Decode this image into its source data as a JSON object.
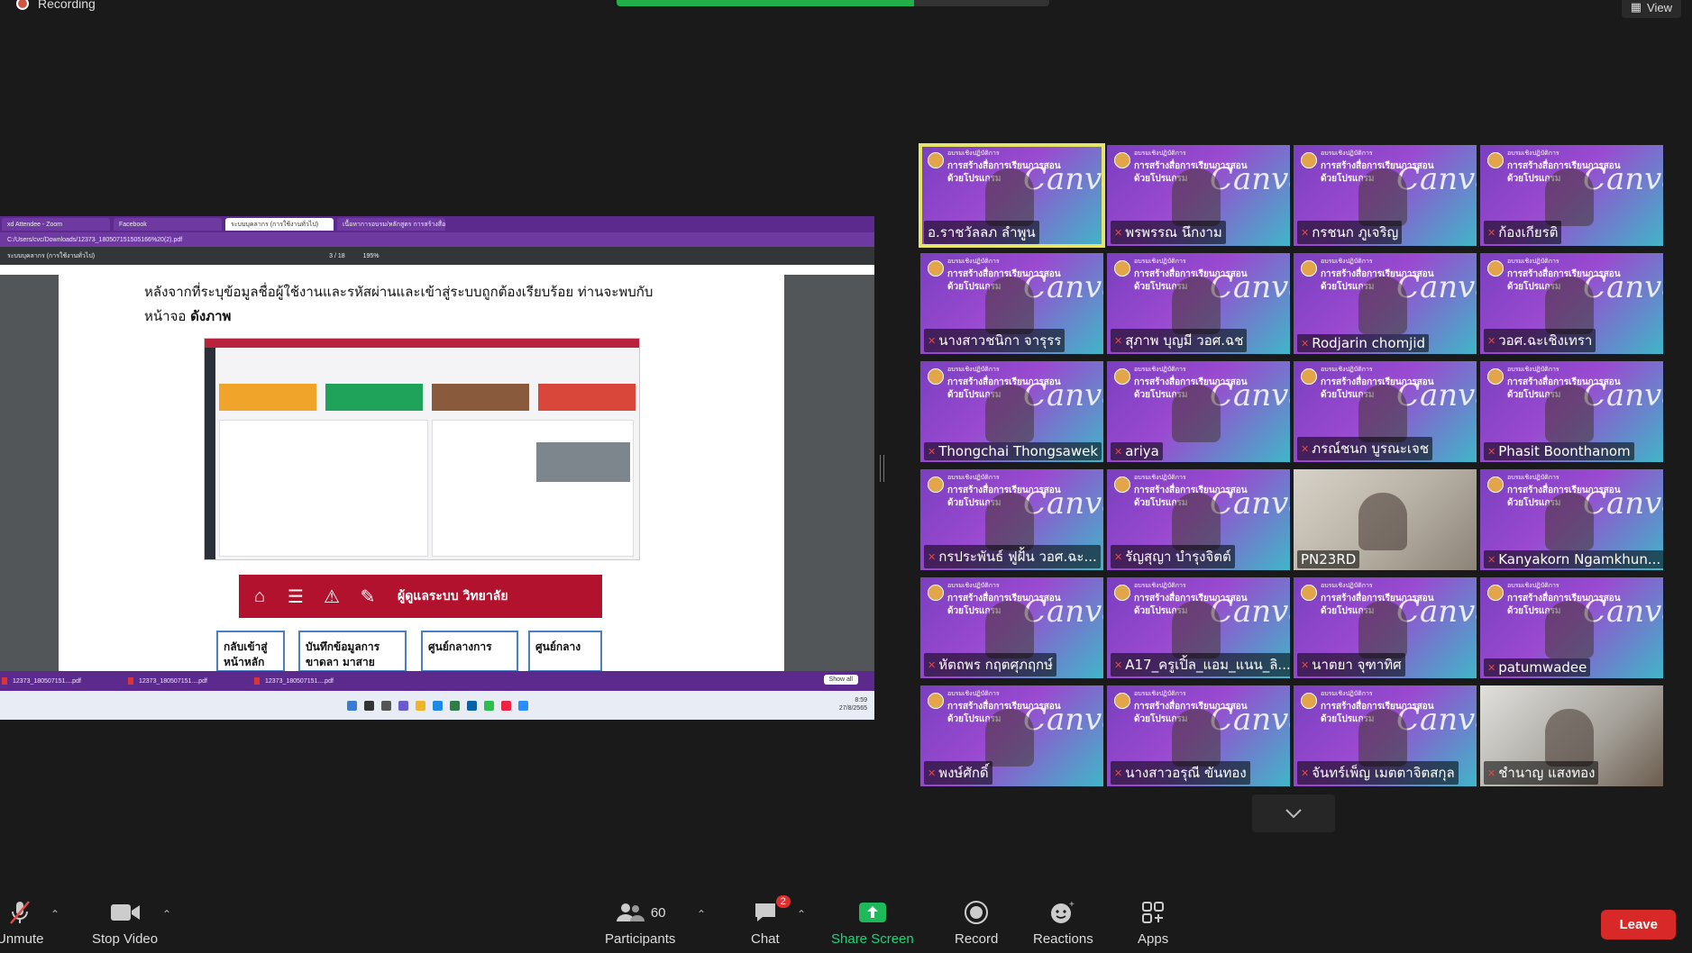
{
  "top": {
    "recording": "Recording",
    "view": "View"
  },
  "shared_screen": {
    "browser_tabs": [
      "xd Attendee - Zoom",
      "Facebook",
      "ระบบบุคลากร (การใช้งานทั่วไป)",
      "เนื้อหาการอบรม/หลักสูตร การสร้างสื่อ..."
    ],
    "address": "C:/Users/cvc/Downloads/12373_180507151505166%20(2).pdf",
    "pdf_title": "ระบบบุคลากร (การใช้งานทั่วไป)",
    "page_indicator": "3 / 18",
    "zoom": "195%",
    "paragraph_line1": "หลังจากที่ระบุข้อมูลชื่อผู้ใช้งานและรหัสผ่านและเข้าสู่ระบบถูกต้องเรียบร้อย ท่านจะพบกับ",
    "paragraph_line2": "หน้าจอ",
    "paragraph_bold": "ดังภาพ",
    "menu_text": "ผู้ดูแลระบบ วิทยาลัย",
    "boxes": [
      "กลับเข้าสู่ หน้าหลัก",
      "บันทึกข้อมูลการ ขาดลา มาสาย",
      "ศูนย์กลางการ",
      "ศูนย์กลาง"
    ],
    "downloads": [
      "12373_180507151....pdf",
      "12373_180507151....pdf",
      "12373_180507151....pdf"
    ],
    "show_all": "Show all",
    "clock_time": "8:59",
    "clock_date": "27/8/2565"
  },
  "gallery": [
    {
      "name": "อ.ราชวัลลภ ลำพูน",
      "muted": false,
      "active": true
    },
    {
      "name": "พรพรรณ นึกงาม",
      "muted": true
    },
    {
      "name": "กรชนก ภูเจริญ",
      "muted": true
    },
    {
      "name": "ก้องเกียรติ",
      "muted": true
    },
    {
      "name": "นางสาวชนิกา จารุรร",
      "muted": true
    },
    {
      "name": "สุภาพ บุญมี วอศ.ฉช",
      "muted": true
    },
    {
      "name": "Rodjarin chomjid",
      "muted": true
    },
    {
      "name": "วอศ.ฉะเชิงเทรา",
      "muted": true
    },
    {
      "name": "Thongchai Thongsawek",
      "muted": true
    },
    {
      "name": "ariya",
      "muted": true
    },
    {
      "name": "ภรณ์ชนก บูรณะเจช",
      "muted": true
    },
    {
      "name": "Phasit Boonthanom",
      "muted": true
    },
    {
      "name": "กรประพันธ์ ฟูฝั้น วอศ.ฉะ...",
      "muted": true
    },
    {
      "name": "รัญสุญา บำรุงจิตต์",
      "muted": true
    },
    {
      "name": "PN23RD",
      "muted": false
    },
    {
      "name": "Kanyakorn Ngamkhun...",
      "muted": true
    },
    {
      "name": "หัตถพร กฤตศุภฤกษ์",
      "muted": true
    },
    {
      "name": "A17_ครูเปิ้ล_แอม_แนน_ลิ...",
      "muted": true
    },
    {
      "name": "นาตยา จุฑาทิศ",
      "muted": true
    },
    {
      "name": "patumwadee",
      "muted": true
    },
    {
      "name": "พงษ์ศักดิ์",
      "muted": true
    },
    {
      "name": "นางสาวอรุณี ขันทอง",
      "muted": true
    },
    {
      "name": "จันทร์เพ็ญ เมตตาจิตสกุล",
      "muted": true
    },
    {
      "name": "ชำนาญ แสงทอง",
      "muted": true
    }
  ],
  "slide": {
    "header": "อบรมเชิงปฏิบัติการ",
    "line1": "การสร้างสื่อการเรียนการสอน",
    "line2": "ด้วยโปรแกรม",
    "brand": "Canva"
  },
  "toolbar": {
    "unmute": "Unmute",
    "stop_video": "Stop Video",
    "participants": "Participants",
    "participants_count": "60",
    "chat": "Chat",
    "chat_badge": "2",
    "share_screen": "Share Screen",
    "record": "Record",
    "reactions": "Reactions",
    "apps": "Apps",
    "leave": "Leave"
  }
}
